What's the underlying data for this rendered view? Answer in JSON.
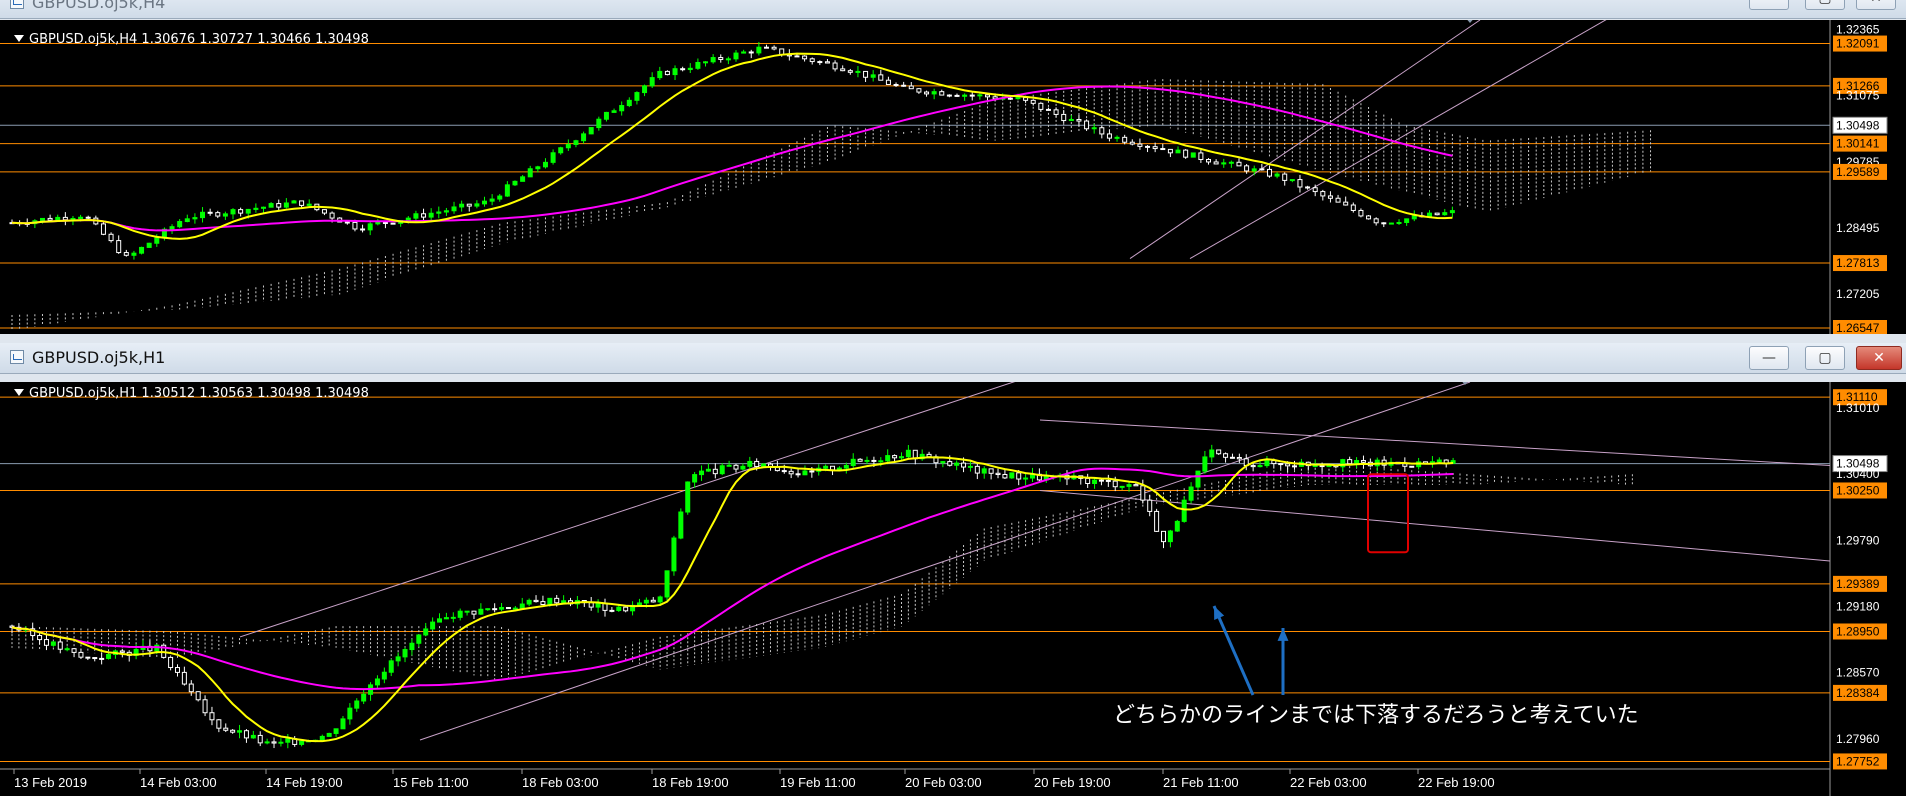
{
  "windows": [
    {
      "id": "h4",
      "title": "GBPUSD.oj5k,H4",
      "title_dim": true,
      "info": "GBPUSD.oj5k,H4  1.30676 1.30727 1.30466 1.30498",
      "price_min": 1.2643,
      "price_max": 1.3255,
      "price_labels": [
        {
          "text": "1.32365",
          "v": 1.32365,
          "style": "plain"
        },
        {
          "text": "1.32091",
          "v": 1.32091,
          "style": "orange"
        },
        {
          "text": "1.31266",
          "v": 1.31266,
          "style": "orange"
        },
        {
          "text": "1.31075",
          "v": 1.31075,
          "style": "plain"
        },
        {
          "text": "1.30498",
          "v": 1.30498,
          "style": "current"
        },
        {
          "text": "1.30141",
          "v": 1.30141,
          "style": "orange"
        },
        {
          "text": "1.29785",
          "v": 1.29785,
          "style": "plain"
        },
        {
          "text": "1.29589",
          "v": 1.29589,
          "style": "orange"
        },
        {
          "text": "1.28495",
          "v": 1.28495,
          "style": "plain"
        },
        {
          "text": "1.27813",
          "v": 1.27813,
          "style": "orange"
        },
        {
          "text": "1.27205",
          "v": 1.27205,
          "style": "plain"
        },
        {
          "text": "1.26547",
          "v": 1.26547,
          "style": "orange"
        }
      ],
      "hlines": [
        1.32091,
        1.31266,
        1.30141,
        1.29589,
        1.27813,
        1.26547
      ],
      "current": 1.30498
    },
    {
      "id": "h1",
      "title": "GBPUSD.oj5k,H1",
      "title_dim": false,
      "info": "GBPUSD.oj5k,H1  1.30512 1.30563 1.30498 1.30498",
      "price_min": 1.2771,
      "price_max": 1.3125,
      "price_labels": [
        {
          "text": "1.31110",
          "v": 1.3111,
          "style": "orange"
        },
        {
          "text": "1.31010",
          "v": 1.3101,
          "style": "plain"
        },
        {
          "text": "1.30498",
          "v": 1.30498,
          "style": "current"
        },
        {
          "text": "1.30400",
          "v": 1.304,
          "style": "plain"
        },
        {
          "text": "1.30250",
          "v": 1.3025,
          "style": "orange"
        },
        {
          "text": "1.29790",
          "v": 1.2979,
          "style": "plain"
        },
        {
          "text": "1.29389",
          "v": 1.29389,
          "style": "orange"
        },
        {
          "text": "1.29180",
          "v": 1.2918,
          "style": "plain"
        },
        {
          "text": "1.28950",
          "v": 1.2895,
          "style": "orange"
        },
        {
          "text": "1.28570",
          "v": 1.2857,
          "style": "plain"
        },
        {
          "text": "1.28384",
          "v": 1.28384,
          "style": "orange"
        },
        {
          "text": "1.27960",
          "v": 1.2796,
          "style": "plain"
        },
        {
          "text": "1.27752",
          "v": 1.27752,
          "style": "orange"
        }
      ],
      "hlines": [
        1.3111,
        1.3025,
        1.29389,
        1.2895,
        1.28384,
        1.27752
      ],
      "current": 1.30498,
      "time_labels": [
        "13 Feb 2019",
        "14 Feb 03:00",
        "14 Feb 19:00",
        "15 Feb 11:00",
        "18 Feb 03:00",
        "18 Feb 19:00",
        "19 Feb 11:00",
        "20 Feb 03:00",
        "20 Feb 19:00",
        "21 Feb 11:00",
        "22 Feb 03:00",
        "22 Feb 19:00"
      ],
      "annotation": "どちらかのラインまでは下落するだろうと考えていた"
    }
  ],
  "colors": {
    "background": "#000000",
    "bull_candle": "#00ff00",
    "bear_candle": "#ffffff",
    "ma_short": "#ffff00",
    "ma_long": "#ff00ff",
    "hline": "#ff8c00",
    "label_orange": "#ff8c00",
    "trendline": "#c8a2c8",
    "cloud": "#c8c8c8",
    "arrow": "#1e6fc4",
    "highlight_box": "#e00000"
  },
  "icons": [
    "chart-window-icon",
    "minimize-icon",
    "maximize-icon",
    "close-icon",
    "dropdown-triangle-icon",
    "arrow-up-icon"
  ]
}
